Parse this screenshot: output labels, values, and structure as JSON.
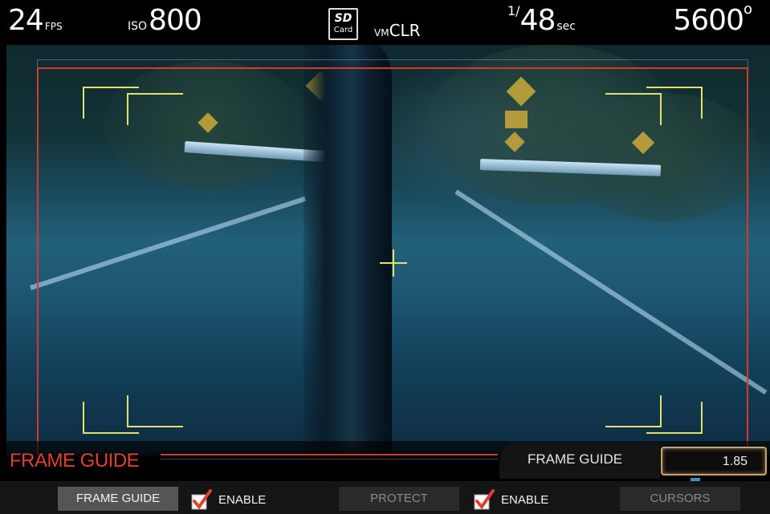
{
  "status": {
    "fps_value": "24",
    "fps_unit": "FPS",
    "iso_label": "ISO",
    "iso_value": "800",
    "card_logo": "SD",
    "card_label": "Card",
    "vm_prefix": "VM",
    "vm_value": "CLR",
    "shutter_numerator": "1/",
    "shutter_value": "48",
    "shutter_unit": "sec",
    "kelvin_value": "5600",
    "kelvin_unit": "o"
  },
  "menu": {
    "title": "FRAME GUIDE",
    "param_label": "FRAME GUIDE",
    "param_value": "1.85"
  },
  "tabs": {
    "frame_guide": "FRAME GUIDE",
    "enable_1": "ENABLE",
    "protect": "PROTECT",
    "enable_2": "ENABLE",
    "cursors": "CURSORS"
  },
  "colors": {
    "guide_red": "#d33a2c",
    "corner_yellow": "#e5e066",
    "check_red": "#e0412f",
    "value_border": "#c9a56a"
  },
  "icons": {
    "sd_card": "sd-card-icon",
    "checkmark": "checkmark-icon",
    "crosshair": "crosshair-icon"
  }
}
